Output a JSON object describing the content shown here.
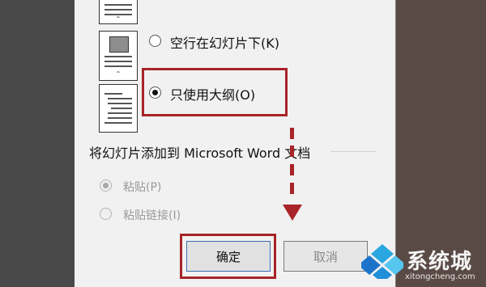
{
  "dialog": {
    "layout_options": [
      {
        "label": "空行在幻灯片下(K)",
        "selected": false
      },
      {
        "label": "只使用大纲(O)",
        "selected": true
      }
    ],
    "paste_section_title": "将幻灯片添加到 Microsoft Word 文档",
    "paste_options": [
      {
        "label": "粘贴(P)",
        "selected": true,
        "enabled": false
      },
      {
        "label": "粘贴链接(I)",
        "selected": false,
        "enabled": false
      }
    ],
    "buttons": {
      "ok": "确定",
      "cancel": "取消"
    }
  },
  "watermark": {
    "name": "系统城",
    "url": "xitongcheng.com"
  },
  "colors": {
    "highlight": "#a82428",
    "dialog_bg": "#f1f1f1"
  }
}
